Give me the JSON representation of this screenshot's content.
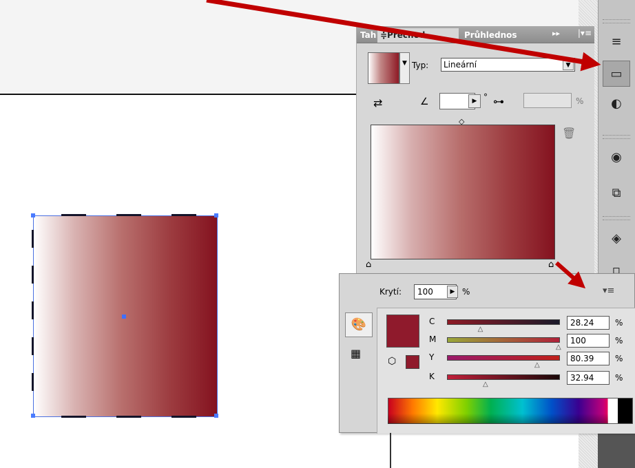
{
  "gradient_panel": {
    "tabs": [
      {
        "label": "Tah"
      },
      {
        "label": "≑Přechod"
      },
      {
        "label": "Průhlednos"
      }
    ],
    "type_label": "Typ:",
    "type_value": "Lineární",
    "degree_symbol": "°",
    "percent": "%"
  },
  "color_panel": {
    "opacity_label": "Krytí:",
    "opacity_value": "100",
    "opacity_unit": "%",
    "fill_color": "#8f1a2c",
    "channels": [
      {
        "label": "C",
        "value": "28.24",
        "unit": "%",
        "level": 0.2824
      },
      {
        "label": "M",
        "value": "100",
        "unit": "%",
        "level": 1.0
      },
      {
        "label": "Y",
        "value": "80.39",
        "unit": "%",
        "level": 0.8039
      },
      {
        "label": "K",
        "value": "32.94",
        "unit": "%",
        "level": 0.3294
      }
    ]
  },
  "colors": {
    "gradient_start": "#ffffff",
    "gradient_end": "#84121f",
    "annotation_arrow": "#c00000",
    "selection": "#4a7bff"
  },
  "icons": [
    "collapse-panel-icon",
    "panel-menu-icon",
    "reverse-gradient-icon",
    "angle-icon",
    "aspect-ratio-icon",
    "delete-stop-icon",
    "midpoint-diamond-icon",
    "stop-icon",
    "stroke-panel-icon",
    "gradient-panel-icon",
    "transparency-panel-icon",
    "appearance-icon",
    "transform-icon",
    "layers-icon",
    "document-icon",
    "color-mode-palette-icon",
    "swatch-grid-icon",
    "out-of-gamut-cube-icon",
    "color-panel-menu-icon"
  ]
}
